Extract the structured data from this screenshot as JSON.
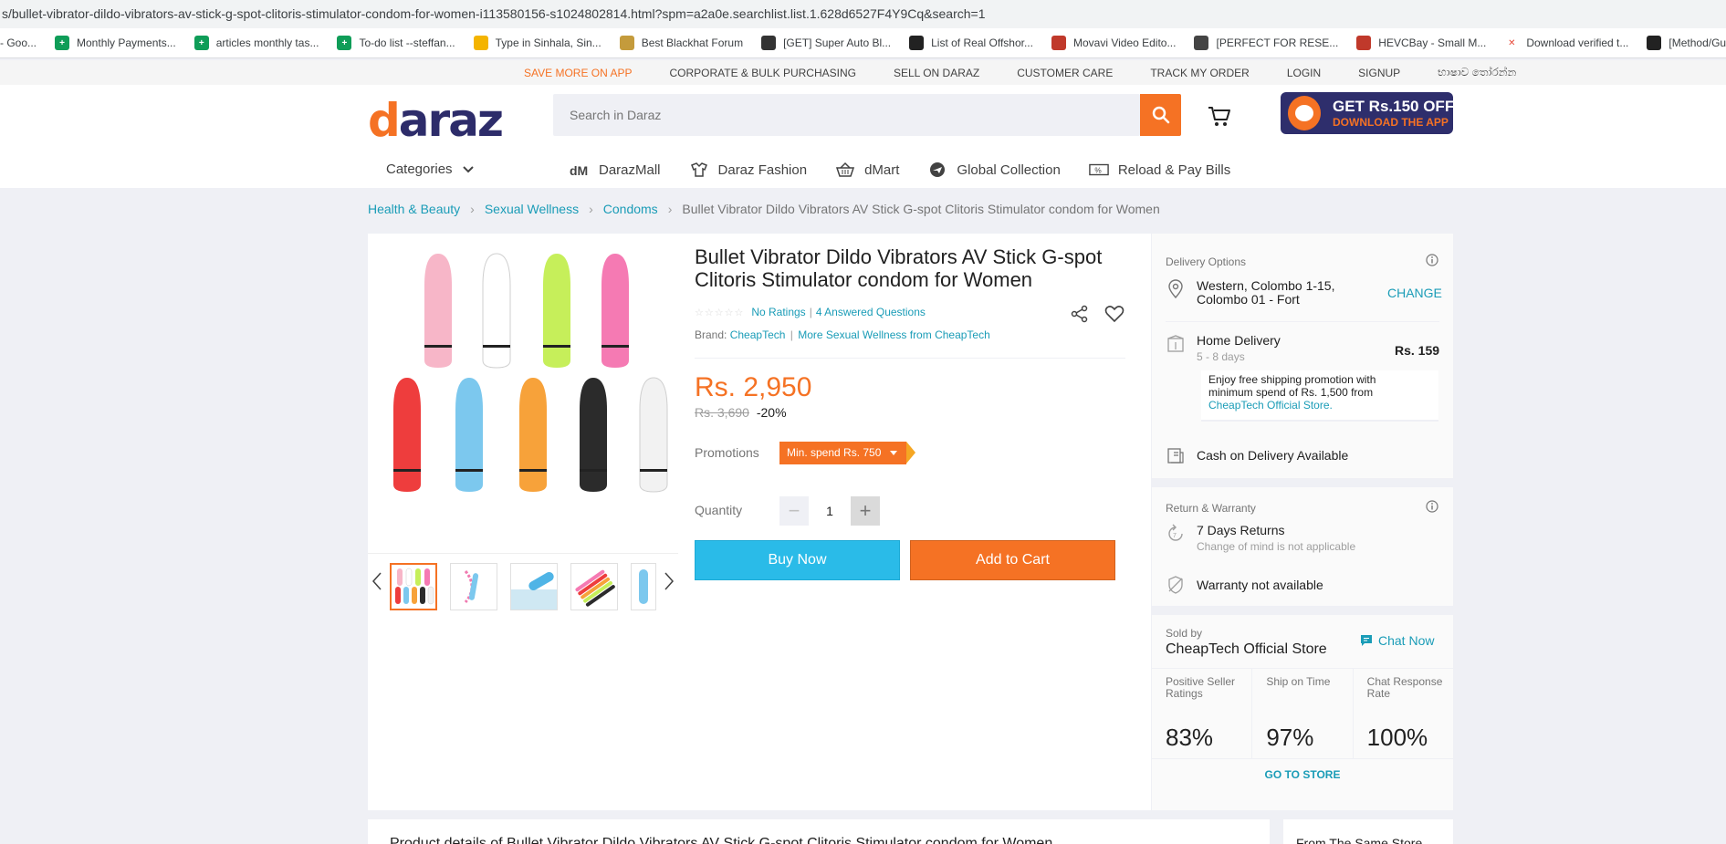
{
  "browser": {
    "url": "s/bullet-vibrator-dildo-vibrators-av-stick-g-spot-clitoris-stimulator-condom-for-women-i113580156-s1024802814.html?spm=a2a0e.searchlist.list.1.628d6527F4Y9Cq&search=1",
    "bookmarks": [
      {
        "label": "- Goo...",
        "icon": "google-icon",
        "color": "#ffffff"
      },
      {
        "label": "Monthly Payments...",
        "icon": "sheets-icon",
        "color": "#0f9d58"
      },
      {
        "label": "articles monthly tas...",
        "icon": "sheets-icon",
        "color": "#0f9d58"
      },
      {
        "label": "To-do list --steffan...",
        "icon": "sheets-icon",
        "color": "#0f9d58"
      },
      {
        "label": "Type in Sinhala, Sin...",
        "icon": "sinhala-icon",
        "color": "#f4b400"
      },
      {
        "label": "Best Blackhat Forum",
        "icon": "forum-icon",
        "color": "#c49b3c"
      },
      {
        "label": "[GET] Super Auto Bl...",
        "icon": "site-icon",
        "color": "#333333"
      },
      {
        "label": "List of Real Offshor...",
        "icon": "bh-icon",
        "color": "#222222"
      },
      {
        "label": "Movavi Video Edito...",
        "icon": "movavi-icon",
        "color": "#c0392b"
      },
      {
        "label": "[PERFECT FOR RESE...",
        "icon": "site-icon",
        "color": "#444444"
      },
      {
        "label": "HEVCBay - Small M...",
        "icon": "hevc-icon",
        "color": "#c0392b"
      },
      {
        "label": "Download verified t...",
        "icon": "x-icon",
        "color": "#e74c3c"
      },
      {
        "label": "[Method/Guide] Bla...",
        "icon": "bh-icon",
        "color": "#222222"
      }
    ]
  },
  "topbar": {
    "links": [
      "SAVE MORE ON APP",
      "CORPORATE & BULK PURCHASING",
      "SELL ON DARAZ",
      "CUSTOMER CARE",
      "TRACK MY ORDER",
      "LOGIN",
      "SIGNUP",
      "භාෂාව තෝරන්න"
    ]
  },
  "header": {
    "logo": "daraz",
    "search_placeholder": "Search in Daraz",
    "app_banner_line1": "GET Rs.150 OFF",
    "app_banner_line2": "DOWNLOAD THE APP",
    "categories_label": "Categories",
    "nav_links": [
      {
        "label": "DarazMall",
        "icon": "darazmall-icon"
      },
      {
        "label": "Daraz Fashion",
        "icon": "fashion-icon"
      },
      {
        "label": "dMart",
        "icon": "basket-icon"
      },
      {
        "label": "Global Collection",
        "icon": "plane-icon"
      },
      {
        "label": "Reload & Pay Bills",
        "icon": "bill-icon"
      }
    ]
  },
  "breadcrumb": {
    "items": [
      "Health & Beauty",
      "Sexual Wellness",
      "Condoms"
    ],
    "current": "Bullet Vibrator Dildo Vibrators AV Stick G-spot Clitoris Stimulator condom for Women"
  },
  "product": {
    "title": "Bullet Vibrator Dildo Vibrators AV Stick G-spot Clitoris Stimulator condom for Women",
    "ratings": "No Ratings",
    "questions": "4 Answered Questions",
    "brand_label": "Brand:",
    "brand": "CheapTech",
    "more_from": "More Sexual Wellness from CheapTech",
    "price": "Rs. 2,950",
    "old_price": "Rs. 3,690",
    "discount": "-20%",
    "promotions_label": "Promotions",
    "promotion_tag": "Min. spend Rs. 750",
    "quantity_label": "Quantity",
    "quantity": "1",
    "buy_now": "Buy Now",
    "add_to_cart": "Add to Cart",
    "bullet_colors": [
      "#f7b6c8",
      "#ffffff",
      "#c6ef5a",
      "#f57ab3",
      "#ee3d3d",
      "#7cc8ee",
      "#f7a23a",
      "#2b2b2b",
      "#f2f2f2"
    ],
    "thumbnail_count": 5
  },
  "delivery": {
    "section_title": "Delivery Options",
    "location_line1": "Western, Colombo 1-15,",
    "location_line2": "Colombo 01 - Fort",
    "change": "CHANGE",
    "home_delivery": "Home Delivery",
    "days": "5 - 8 days",
    "fee": "Rs. 159",
    "promo_line1": "Enjoy free shipping promotion with",
    "promo_line2": "minimum spend of Rs. 1,500 from",
    "promo_store": "CheapTech Official Store.",
    "cod": "Cash on Delivery Available"
  },
  "returns": {
    "section_title": "Return & Warranty",
    "days_returns": "7 Days Returns",
    "returns_note": "Change of mind is not applicable",
    "warranty": "Warranty not available"
  },
  "seller": {
    "sold_by": "Sold by",
    "name": "CheapTech Official Store",
    "chat": "Chat Now",
    "metrics": [
      {
        "label": "Positive Seller Ratings",
        "value": "83%"
      },
      {
        "label": "Ship on Time",
        "value": "97%"
      },
      {
        "label": "Chat Response Rate",
        "value": "100%"
      }
    ],
    "go_to_store": "GO TO STORE"
  },
  "bottom": {
    "details_title": "Product details of Bullet Vibrator Dildo Vibrators AV Stick G-spot Clitoris Stimulator condom for Women",
    "from_store": "From The Same Store"
  },
  "colors": {
    "accent": "#f57224",
    "link": "#1a9cb7",
    "buy_now": "#2abbe8"
  }
}
